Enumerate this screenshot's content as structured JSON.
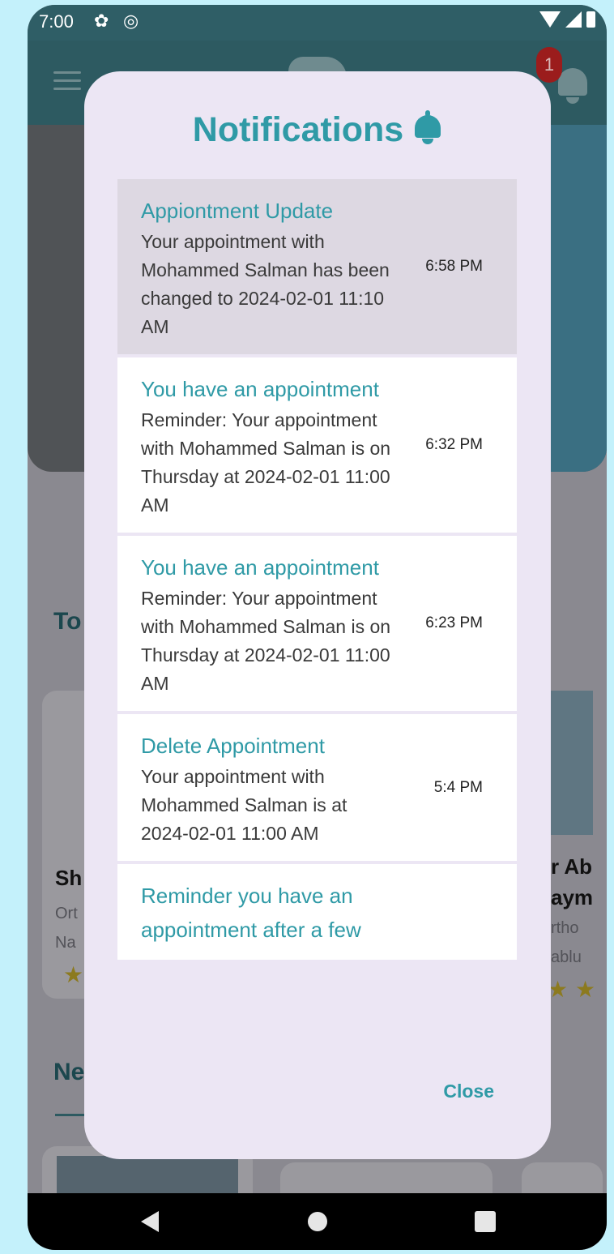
{
  "status_bar": {
    "time": "7:00"
  },
  "header": {
    "notification_count": "1"
  },
  "background": {
    "section_top_rated": "To",
    "section_news": "Ne",
    "card_left": {
      "name": "Sh",
      "specialty": "Ort",
      "location": "Na"
    },
    "card_right": {
      "name_line1": "r Ab",
      "name_line2": "aym",
      "specialty": "rtho",
      "location": "ablu"
    }
  },
  "dialog": {
    "title": "Notifications",
    "close_label": "Close",
    "notifications": [
      {
        "title": "Appiontment Update",
        "body": "Your appointment with Mohammed Salman has been changed to 2024-02-01 11:10 AM",
        "time": "6:58 PM",
        "highlighted": true
      },
      {
        "title": "You have an appointment",
        "body": "Reminder: Your appointment with Mohammed Salman is on Thursday at 2024-02-01 11:00 AM",
        "time": "6:32 PM"
      },
      {
        "title": "You have an appointment",
        "body": "Reminder: Your appointment with Mohammed Salman is on Thursday at 2024-02-01 11:00 AM",
        "time": "6:23 PM"
      },
      {
        "title": "Delete Appointment",
        "body": "Your appointment with Mohammed Salman is at 2024-02-01 11:00 AM",
        "time": "5:4 PM"
      },
      {
        "title": "Reminder you have an appointment after a few",
        "body": "",
        "time": ""
      }
    ]
  },
  "colors": {
    "accent": "#2f9aa6",
    "dialog_bg": "#ece6f4",
    "badge": "#9b1c1c",
    "page_bg": "#c4f1fb"
  }
}
